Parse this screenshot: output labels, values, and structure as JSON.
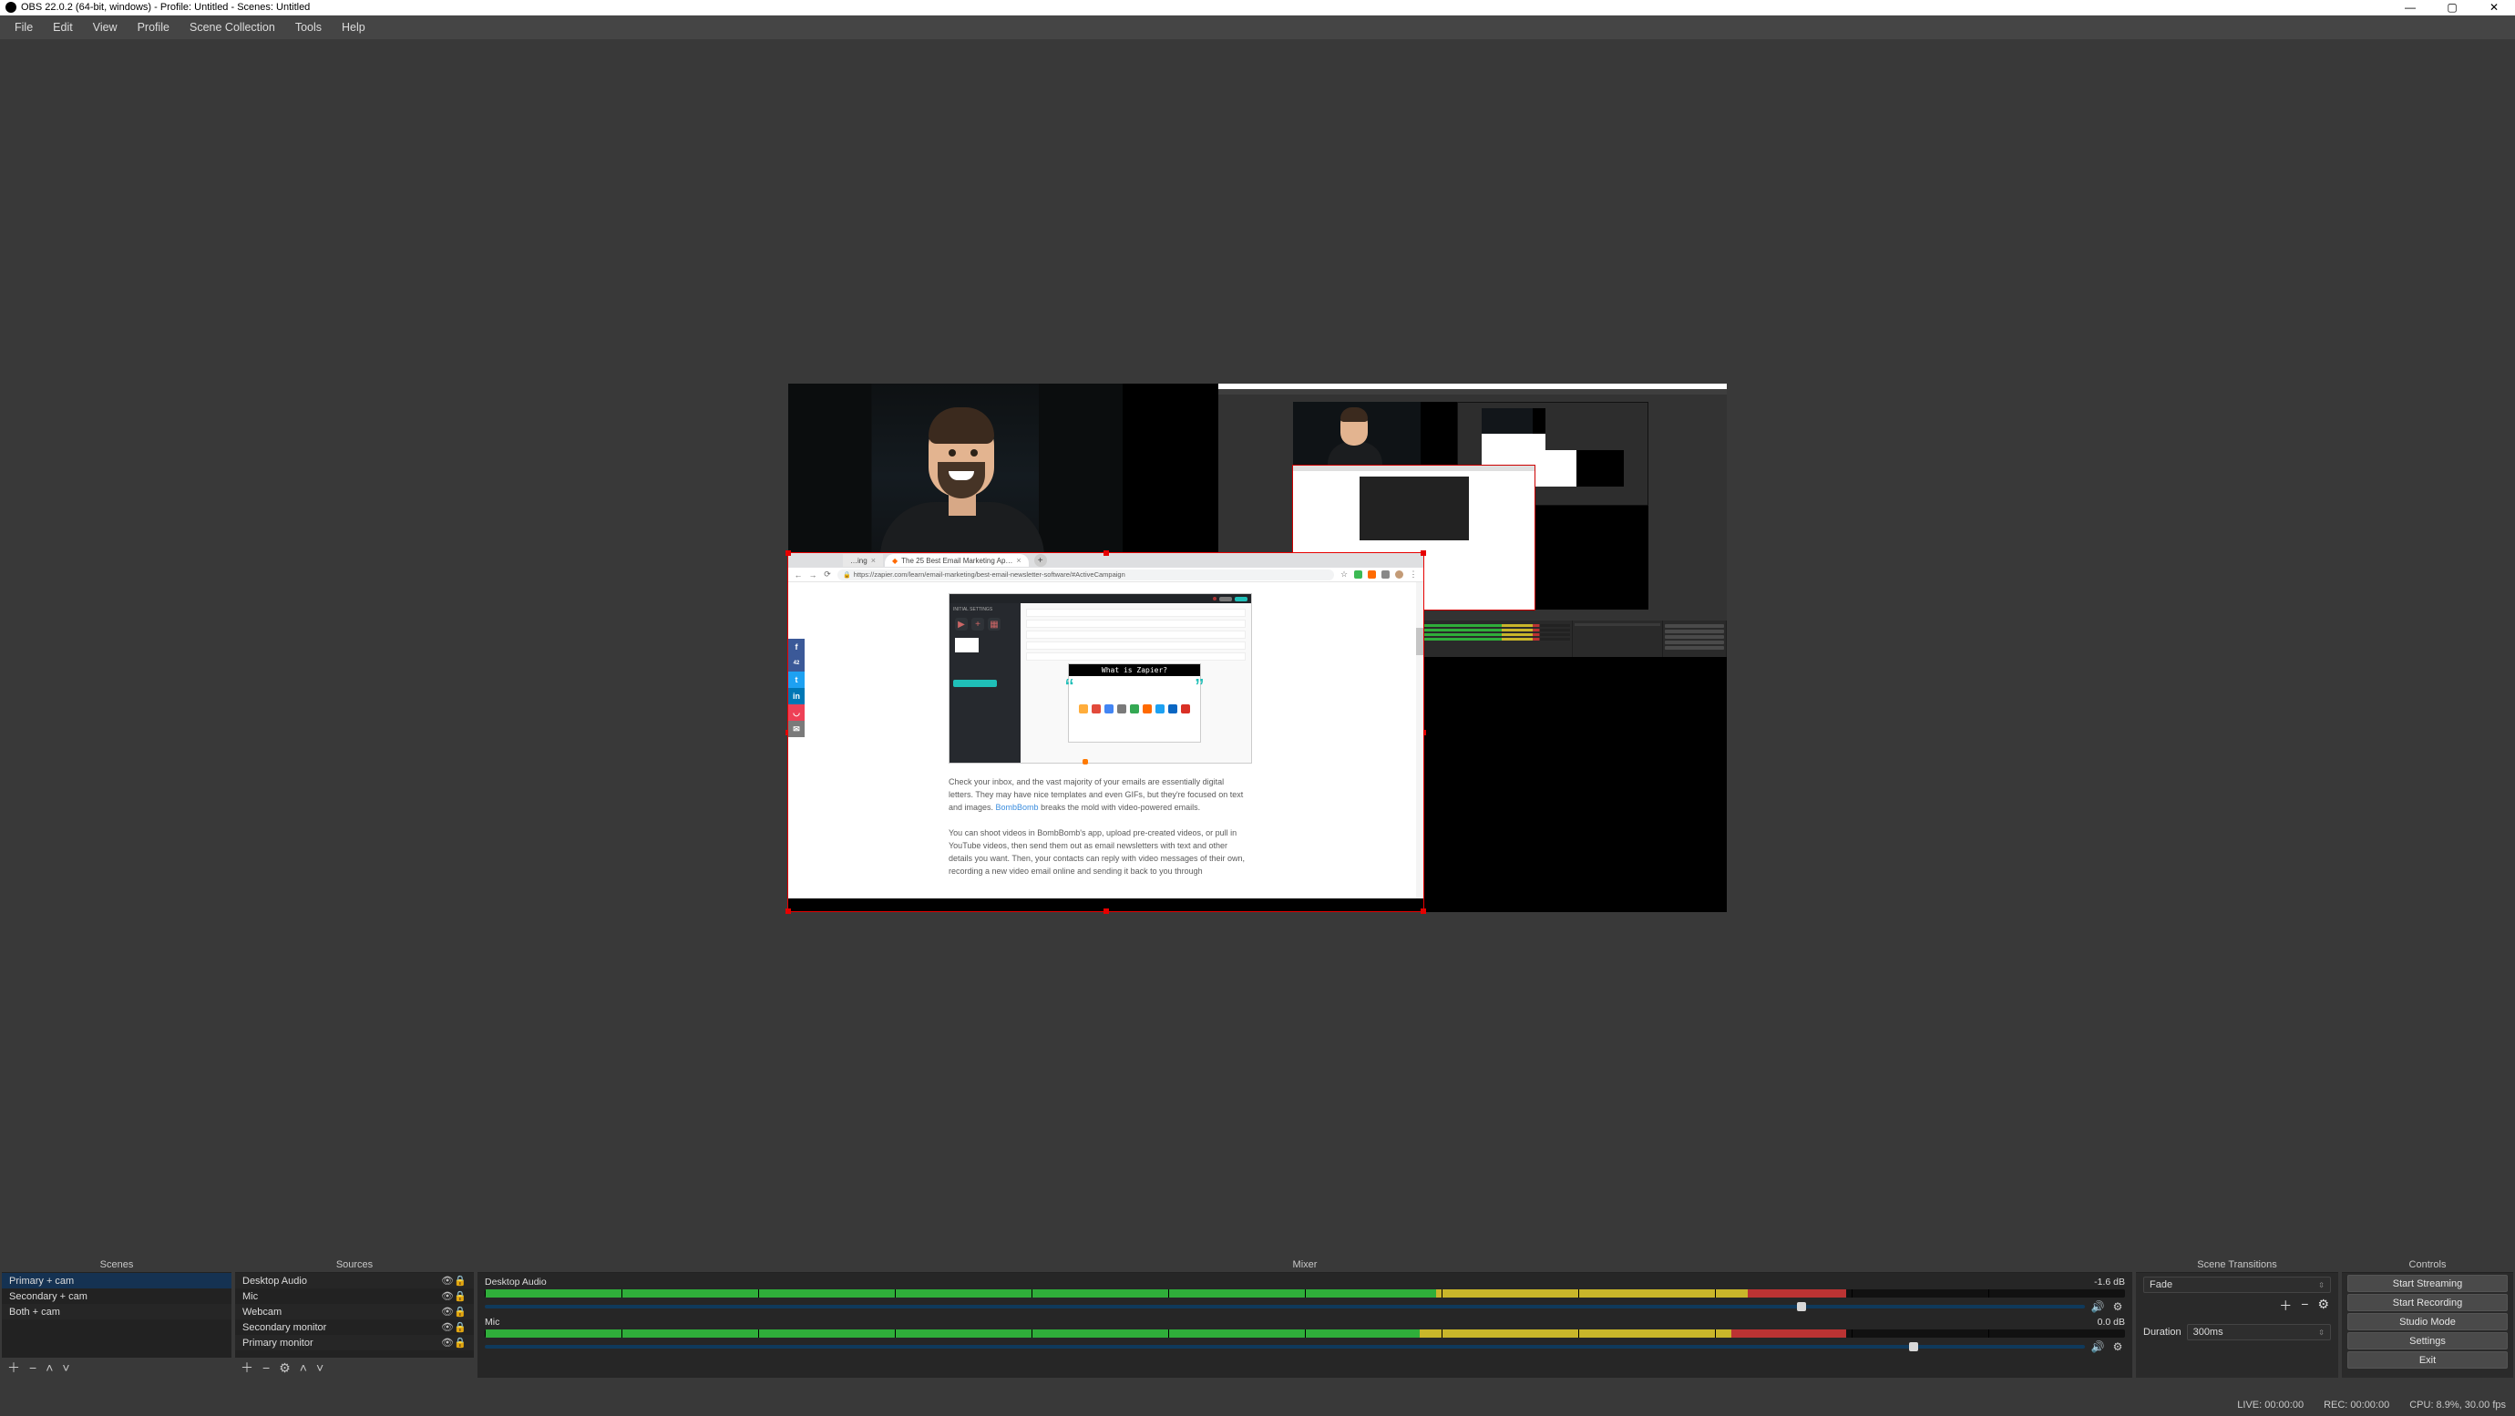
{
  "titlebar": {
    "title": "OBS 22.0.2 (64-bit, windows) - Profile: Untitled - Scenes: Untitled"
  },
  "menu": [
    "File",
    "Edit",
    "View",
    "Profile",
    "Scene Collection",
    "Tools",
    "Help"
  ],
  "preview": {
    "browser": {
      "tab_1_short": "…ing",
      "tab_active": "The 25 Best Email Marketing Ap…",
      "url": "https://zapier.com/learn/email-marketing/best-email-newsletter-software/#ActiveCampaign",
      "social_share_count": "42",
      "card_title": "What is Zapier?",
      "leftpanel_label": "INITIAL SETTINGS",
      "paragraph1_a": "Check your inbox, and the vast majority of your emails are essentially digital letters. They may have nice templates and even GIFs, but they're focused on text and images. ",
      "paragraph1_link": "BombBomb",
      "paragraph1_b": " breaks the mold with video-powered emails.",
      "paragraph2": "You can shoot videos in BombBomb's app, upload pre-created videos, or pull in YouTube videos, then send them out as email newsletters with text and other details you want. Then, your contacts can reply with video messages of their own, recording a new video email online and sending it back to you through"
    }
  },
  "panels": {
    "scenes_title": "Scenes",
    "sources_title": "Sources",
    "mixer_title": "Mixer",
    "transitions_title": "Scene Transitions",
    "controls_title": "Controls"
  },
  "scenes": [
    {
      "name": "Primary + cam",
      "selected": true
    },
    {
      "name": "Secondary + cam",
      "selected": false
    },
    {
      "name": "Both + cam",
      "selected": false
    }
  ],
  "sources": [
    {
      "name": "Desktop Audio"
    },
    {
      "name": "Mic"
    },
    {
      "name": "Webcam"
    },
    {
      "name": "Secondary monitor"
    },
    {
      "name": "Primary monitor"
    }
  ],
  "mixer": {
    "tracks": [
      {
        "name": "Desktop Audio",
        "db": "-1.6 dB",
        "meter_g": 0.58,
        "meter_y": 0.19,
        "meter_r": 0.06,
        "slider": 0.82
      },
      {
        "name": "Mic",
        "db": "0.0 dB",
        "meter_g": 0.57,
        "meter_y": 0.19,
        "meter_r": 0.07,
        "slider": 0.89
      }
    ]
  },
  "transitions": {
    "current": "Fade",
    "duration_label": "Duration",
    "duration_value": "300ms"
  },
  "controls": {
    "buttons": [
      "Start Streaming",
      "Start Recording",
      "Studio Mode",
      "Settings",
      "Exit"
    ]
  },
  "status": {
    "live": "LIVE: 00:00:00",
    "rec": "REC: 00:00:00",
    "cpu": "CPU: 8.9%, 30.00 fps"
  }
}
